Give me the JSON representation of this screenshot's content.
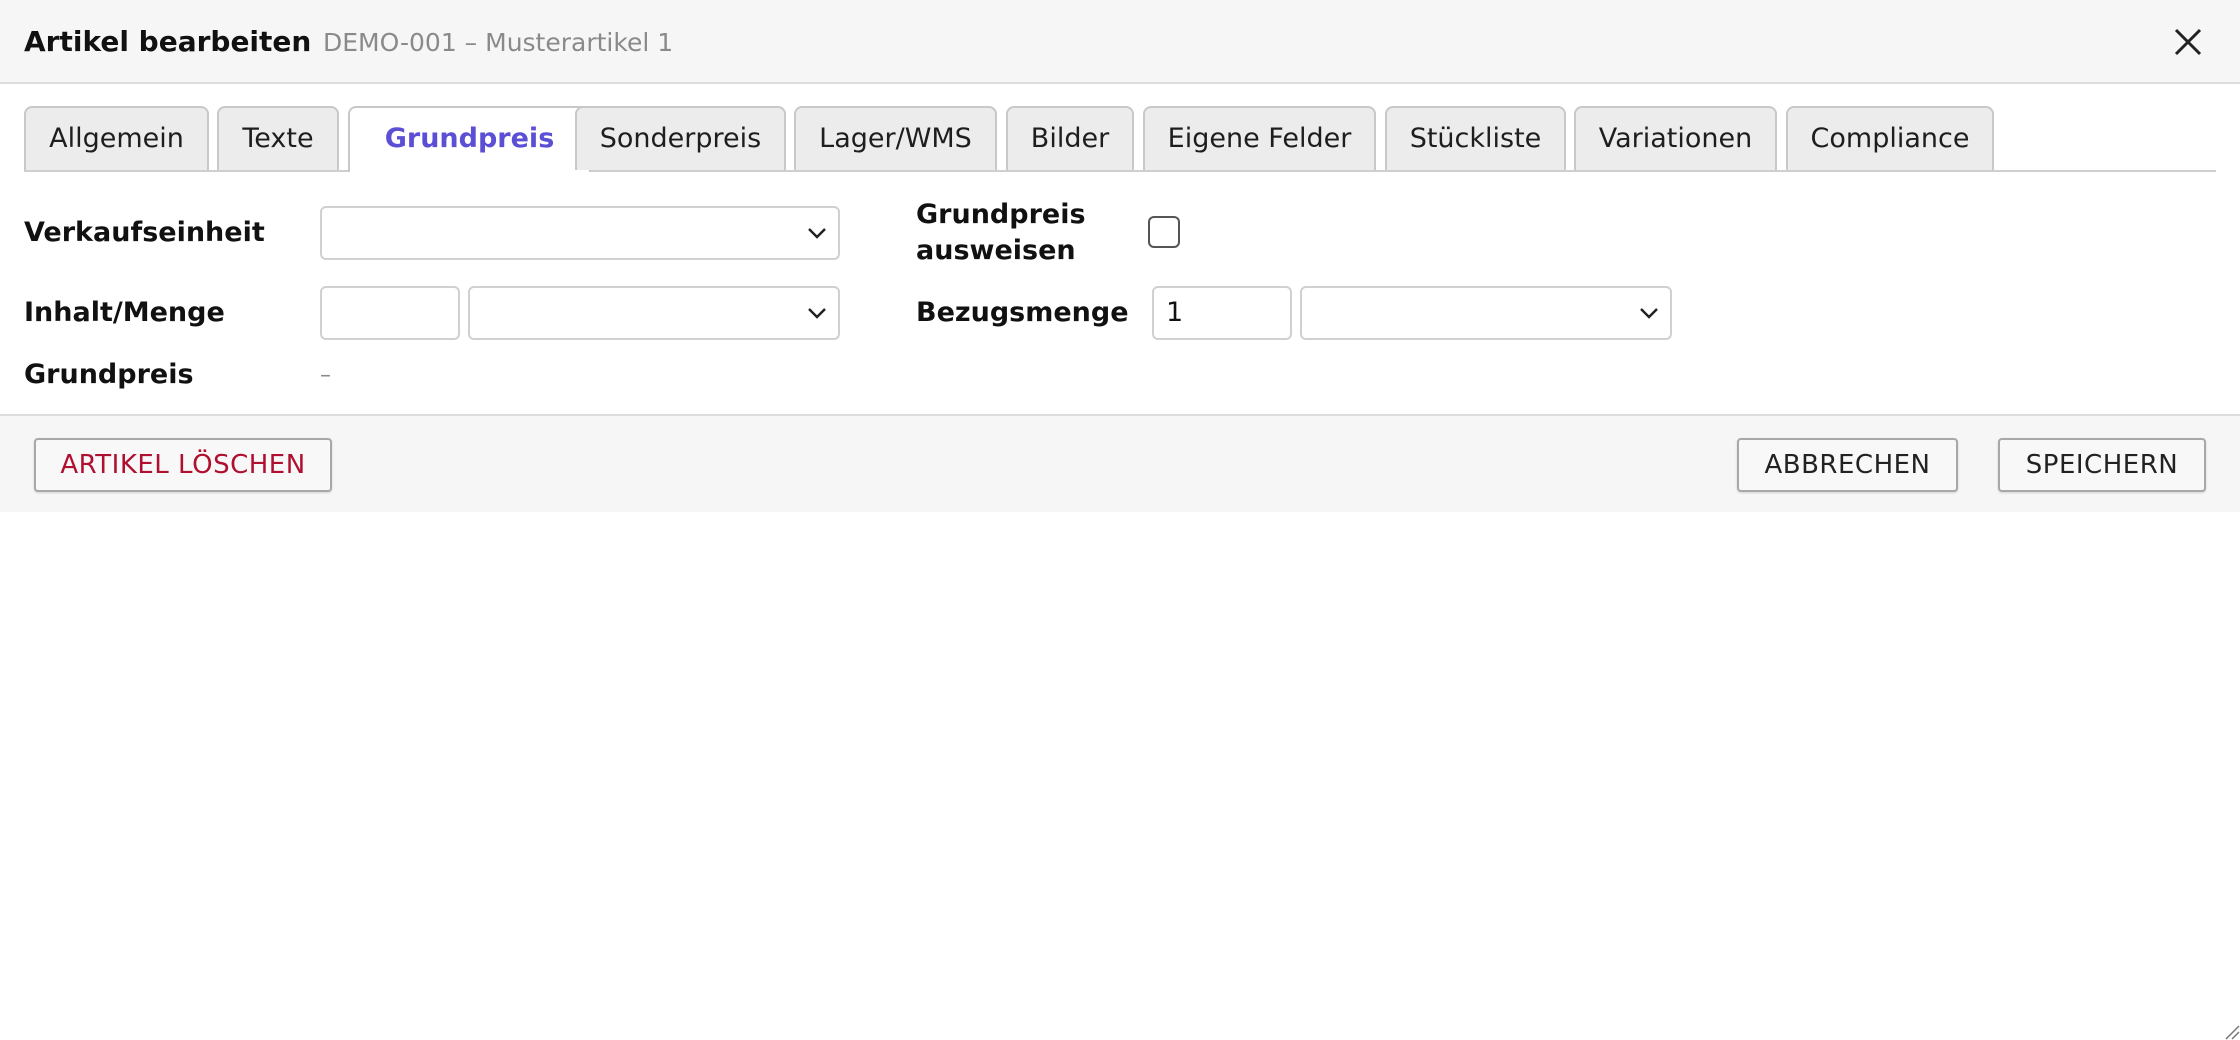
{
  "dialog": {
    "title": "Artikel bearbeiten",
    "subtitle": "DEMO-001 – Musterartikel 1",
    "close_icon": "close-icon"
  },
  "tabs": [
    {
      "label": "Allgemein",
      "active": false
    },
    {
      "label": "Texte",
      "active": false
    },
    {
      "label": "Grundpreis",
      "active": true
    },
    {
      "label": "Sonderpreis",
      "active": false
    },
    {
      "label": "Lager/WMS",
      "active": false
    },
    {
      "label": "Bilder",
      "active": false
    },
    {
      "label": "Eigene Felder",
      "active": false
    },
    {
      "label": "Stückliste",
      "active": false
    },
    {
      "label": "Variationen",
      "active": false
    },
    {
      "label": "Compliance",
      "active": false
    }
  ],
  "form": {
    "verkaufseinheit": {
      "label": "Verkaufseinheit",
      "value": ""
    },
    "grundpreis_ausweisen": {
      "label_line1": "Grundpreis",
      "label_line2": "ausweisen",
      "checked": false
    },
    "inhalt_menge": {
      "label": "Inhalt/Menge",
      "amount": "",
      "unit": ""
    },
    "bezugsmenge": {
      "label": "Bezugsmenge",
      "amount": "1",
      "unit": ""
    },
    "grundpreis": {
      "label": "Grundpreis",
      "value": "–"
    }
  },
  "footer": {
    "delete_label": "ARTIKEL LÖSCHEN",
    "cancel_label": "ABBRECHEN",
    "save_label": "SPEICHERN"
  },
  "colors": {
    "active_tab": "#5b4fd6",
    "danger": "#b01030",
    "header_bg": "#f6f6f6"
  }
}
